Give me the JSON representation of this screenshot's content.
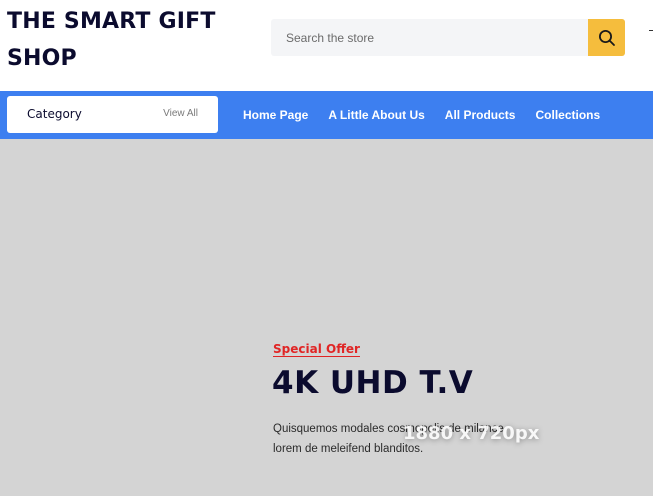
{
  "header": {
    "logo_text": "THE SMART GIFT SHOP",
    "search": {
      "placeholder": "Search the store",
      "value": ""
    }
  },
  "navbar": {
    "category_label": "Category",
    "view_all_label": "View All",
    "links": [
      {
        "label": "Home Page"
      },
      {
        "label": "A Little About Us"
      },
      {
        "label": "All Products"
      },
      {
        "label": "Collections"
      }
    ]
  },
  "hero": {
    "offer_label": "Special Offer",
    "title": "4K UHD T.V",
    "description": "Quisquemos modales cosmopolis de milance lorem de meleifend blanditos.",
    "placeholder_size": "1880 x 720px"
  },
  "colors": {
    "nav_background": "#3d7ff0",
    "search_button": "#f5bd3d",
    "offer_red": "#e02525",
    "hero_background": "#d4d4d4",
    "text_dark": "#0b0b2e"
  },
  "icons": {
    "search": "search-icon"
  }
}
